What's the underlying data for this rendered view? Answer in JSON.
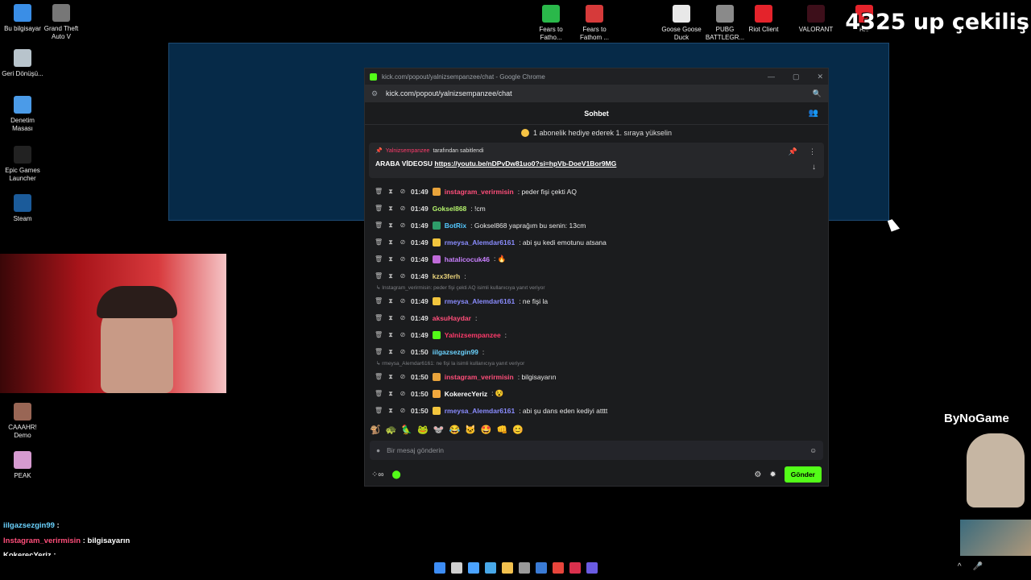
{
  "desktop_left": [
    {
      "label": "Bu bilgisayar",
      "color": "#3a8ee6"
    },
    {
      "label": "Grand Theft Auto V",
      "color": "#777777"
    },
    {
      "label": "Geri Dönüşü...",
      "color": "#b8c4cc"
    },
    {
      "label": "Denetim Masası",
      "color": "#4b9be8"
    },
    {
      "label": "Epic Games Launcher",
      "color": "#222222"
    },
    {
      "label": "Steam",
      "color": "#1b5b9a"
    },
    {
      "label": "CAAAHR! Demo",
      "color": "#996655"
    },
    {
      "label": "PEAK",
      "color": "#d69ad0"
    }
  ],
  "desktop_top": [
    {
      "label": "Fears to Fatho...",
      "color": "#2ab84a"
    },
    {
      "label": "Fears to Fathom ...",
      "color": "#d63a3a"
    },
    {
      "label": "Goose Goose Duck",
      "color": "#e8e8e8"
    },
    {
      "label": "PUBG BATTLEGR...",
      "color": "#8a8a8a"
    },
    {
      "label": "Riot Client",
      "color": "#e4232b"
    },
    {
      "label": "VALORANT",
      "color": "#3d0f1a"
    },
    {
      "label": "Rio",
      "color": "#e4232b"
    }
  ],
  "watermark": "4325 up çekiliş",
  "browser": {
    "title": "kick.com/popout/yalnizsempanzee/chat - Google Chrome",
    "url": "kick.com/popout/yalnizsempanzee/chat",
    "min": "—",
    "max": "▢",
    "close": "✕"
  },
  "chat": {
    "header": "Sohbet",
    "promo": "1 abonelik hediye ederek 1. sıraya yükselin",
    "pinned_user": "Yalnizsempanzee",
    "pinned_by_text": "tarafından sabitlendi",
    "pinned_label": "ARABA VİDEOSU",
    "pinned_link": "https://youtu.be/nDPvDw81uo0?si=hpVb-DoeV1Bor9MG",
    "messages": [
      {
        "time": "01:49",
        "user": "instagram_verirmisin",
        "text": ": peder fişi çekti AQ",
        "color": "#ff4e7a",
        "badge": "#e8a33b"
      },
      {
        "time": "01:49",
        "user": "Goksel868",
        "text": ": !cm",
        "color": "#b4f26c",
        "badge": ""
      },
      {
        "time": "01:49",
        "user": "BotRix",
        "text": ": Goksel868 yaprağım bu senin: 13cm",
        "color": "#53c8ff",
        "badge": "#2e9c6a"
      },
      {
        "time": "01:49",
        "user": "rmeysa_Alemdar6161",
        "text": ": abi şu kedi emotunu atsana",
        "color": "#8a8cff",
        "badge": "#f2c53d"
      },
      {
        "time": "01:49",
        "user": "hatalicocuk46",
        "text": ": 🔥",
        "color": "#c980ff",
        "badge": "#c06bd9"
      },
      {
        "time": "01:49",
        "user": "kzx3ferh",
        "text": ":",
        "color": "#e8d27a",
        "badge": ""
      },
      {
        "reply": "Instagram_verirmisin: peder fişi çekti AQ isimli kullanıcıya yanıt veriyor"
      },
      {
        "time": "01:49",
        "user": "rmeysa_Alemdar6161",
        "text": ": ne fişi la",
        "color": "#8a8cff",
        "badge": "#f2c53d"
      },
      {
        "time": "01:49",
        "user": "aksuHaydar",
        "text": ":",
        "color": "#ff4e7a",
        "badge": ""
      },
      {
        "time": "01:49",
        "user": "Yalnizsempanzee",
        "text": ":",
        "color": "#ff3b6b",
        "badge": "#53fc18"
      },
      {
        "time": "01:50",
        "user": "iilgazsezgin99",
        "text": ":",
        "color": "#6bd3ff",
        "badge": ""
      },
      {
        "reply": "rmeysa_Alemdar6161: ne fişi la isimli kullanıcıya yanıt veriyor"
      },
      {
        "time": "01:50",
        "user": "instagram_verirmisin",
        "text": ": bilgisayarın",
        "color": "#ff4e7a",
        "badge": "#e8a33b"
      },
      {
        "time": "01:50",
        "user": "KokerecYeriz",
        "text": ": 😵",
        "color": "#ffffff",
        "badge": "#f2a83d"
      },
      {
        "time": "01:50",
        "user": "rmeysa_Alemdar6161",
        "text": ": abi şu dans eden kediyi atttt",
        "color": "#8a8cff",
        "badge": "#f2c53d"
      }
    ],
    "emote_row": [
      "🐒",
      "🐢",
      "🦜",
      "🐸",
      "🐭",
      "😂",
      "🐱",
      "🤩",
      "👊",
      "😊"
    ],
    "input_placeholder": "Bir mesaj gönderin",
    "send_label": "Gönder"
  },
  "stream_overlay": [
    {
      "user": "iilgazsezgin99",
      "text": ":",
      "color": "#6bd3ff"
    },
    {
      "user": "Instagram_verirmisin",
      "text": ": bilgisayarın",
      "color": "#ff4e7a"
    },
    {
      "user": "KokerecYeriz",
      "text": ":",
      "color": "#ffffff"
    },
    {
      "user": "rmeysa_Alemdar6161",
      "text": ": abi şu dans eden kediyi atttt",
      "color": "#8a8cff"
    }
  ],
  "bynogame": "ByNoGame",
  "taskbar_icons": [
    "#3d8df5",
    "#cfcfcf",
    "#4ba3ff",
    "#48a8e8",
    "#f2c14e",
    "#9a9a9a",
    "#3a7bd5",
    "#e8453c",
    "#d9304d",
    "#6a5be2"
  ]
}
